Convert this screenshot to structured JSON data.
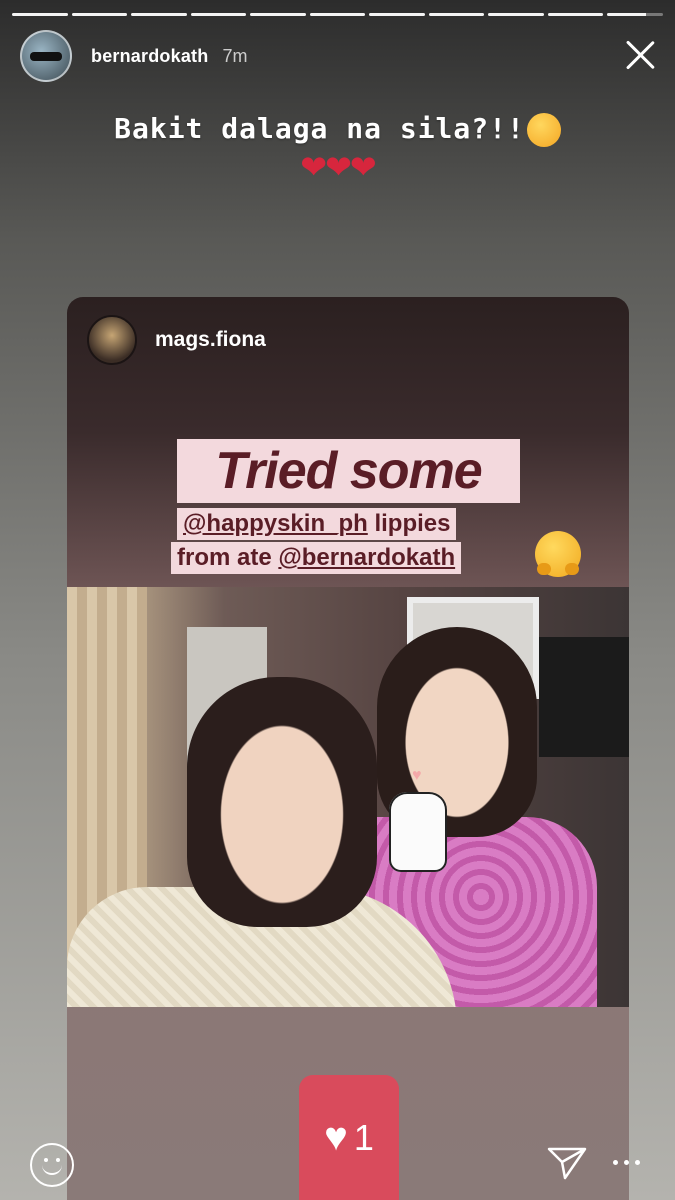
{
  "story": {
    "progress_segments": 11,
    "current_segment_progress": 0.7,
    "user": {
      "username": "bernardokath",
      "time_ago": "7m"
    },
    "caption": "Bakit dalaga na sila?!!",
    "caption_emoji": "sneezing-face-emoji",
    "hearts": "❤❤❤"
  },
  "shared_post": {
    "username": "mags.fiona",
    "label_big": "Tried some",
    "line1_mention": "@happyskin_ph",
    "line1_text": " lippies",
    "line2_text": "from ate ",
    "line2_mention": "@bernardokath",
    "emoji": "hugging-face-emoji"
  },
  "reactions": {
    "like_count": "1"
  },
  "icons": {
    "close": "close-icon",
    "emoji_reply": "smiley-icon",
    "send": "send-icon",
    "more": "more-icon"
  },
  "colors": {
    "label_bg": "#f3d9dd",
    "label_text": "#5a1d26",
    "like_badge": "#d94b5c",
    "hearts": "#d7263d"
  }
}
